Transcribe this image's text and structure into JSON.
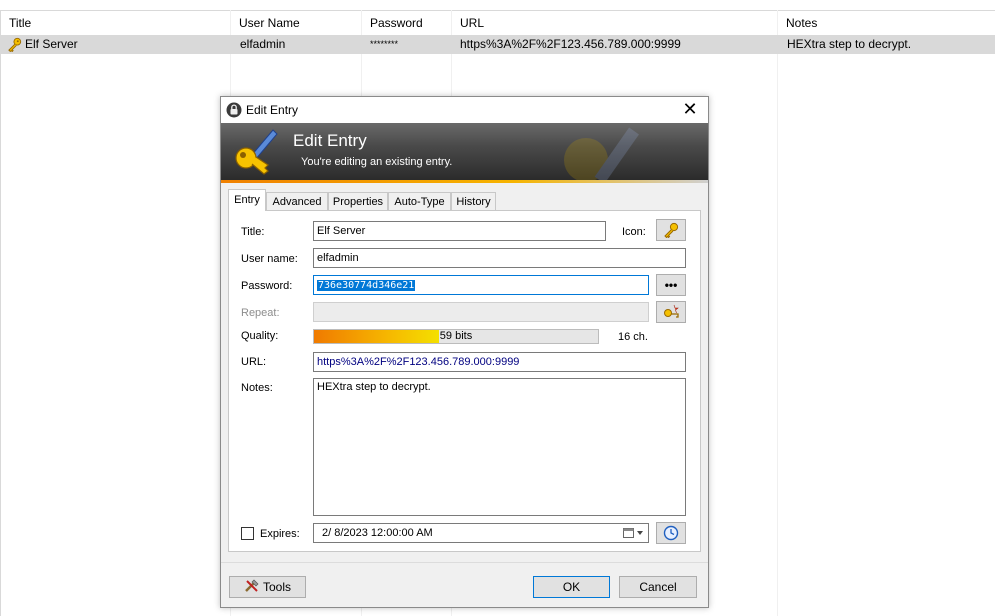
{
  "list": {
    "columns": [
      "Title",
      "User Name",
      "Password",
      "URL",
      "Notes"
    ],
    "rows": [
      {
        "title": "Elf Server",
        "username": "elfadmin",
        "password": "********",
        "url": "https%3A%2F%2F123.456.789.000:9999",
        "notes": "HEXtra step to decrypt."
      }
    ]
  },
  "dialog": {
    "window_title": "Edit Entry",
    "banner_title": "Edit Entry",
    "banner_subtitle": "You're editing an existing entry.",
    "tabs": [
      "Entry",
      "Advanced",
      "Properties",
      "Auto-Type",
      "History"
    ],
    "active_tab": "Entry",
    "labels": {
      "title": "Title:",
      "icon": "Icon:",
      "username": "User name:",
      "password": "Password:",
      "repeat": "Repeat:",
      "quality": "Quality:",
      "url": "URL:",
      "notes": "Notes:",
      "expires": "Expires:"
    },
    "values": {
      "title": "Elf Server",
      "username": "elfadmin",
      "password": "736e30774d346e21",
      "repeat": "",
      "quality_text": "59 bits",
      "quality_fraction": 0.44,
      "char_count": "16 ch.",
      "url": "https%3A%2F%2F123.456.789.000:9999",
      "notes": "HEXtra step to decrypt.",
      "expires_checked": false,
      "expires_date": "2/  8/2023 12:00:00 AM"
    },
    "buttons": {
      "show_password": "•••",
      "tools": "Tools",
      "ok": "OK",
      "cancel": "Cancel"
    },
    "close_glyph": "✕",
    "colors": {
      "selection": "#0078d7",
      "quality_start": "#f07a00",
      "quality_end": "#f4e000",
      "row_highlight": "#d9d9d9"
    }
  }
}
